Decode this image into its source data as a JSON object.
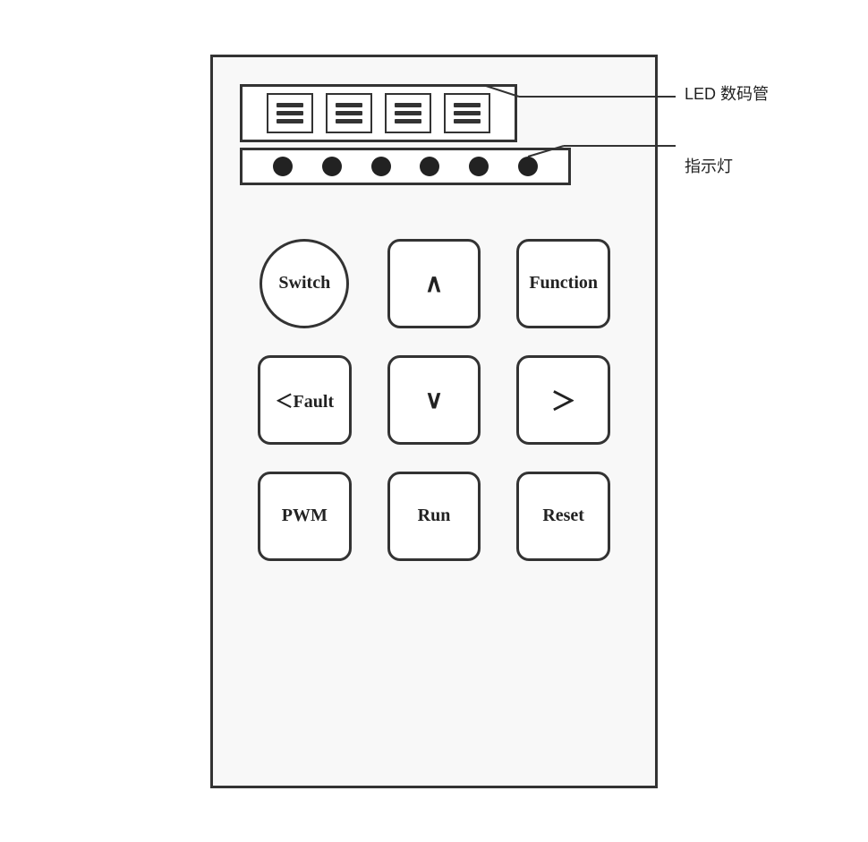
{
  "panel": {
    "led_label": "LED 数码管",
    "indicator_label": "指示灯",
    "led_digits": [
      "digit1",
      "digit2",
      "digit3",
      "digit4"
    ],
    "indicator_dots": [
      1,
      2,
      3,
      4,
      5,
      6
    ],
    "buttons": [
      {
        "id": "switch",
        "label": "Switch",
        "type": "circle",
        "row": 1,
        "col": 1
      },
      {
        "id": "up",
        "label": "∧",
        "type": "square",
        "row": 1,
        "col": 2
      },
      {
        "id": "function",
        "label": "Function",
        "type": "square",
        "row": 1,
        "col": 3
      },
      {
        "id": "fault",
        "label": "＜Fault",
        "type": "square",
        "row": 2,
        "col": 1
      },
      {
        "id": "down",
        "label": "∨",
        "type": "square",
        "row": 2,
        "col": 2
      },
      {
        "id": "right",
        "label": "＞",
        "type": "square",
        "row": 2,
        "col": 3
      },
      {
        "id": "pwm",
        "label": "PWM",
        "type": "square",
        "row": 3,
        "col": 1
      },
      {
        "id": "run",
        "label": "Run",
        "type": "square",
        "row": 3,
        "col": 2
      },
      {
        "id": "reset",
        "label": "Reset",
        "type": "square",
        "row": 3,
        "col": 3
      }
    ]
  }
}
